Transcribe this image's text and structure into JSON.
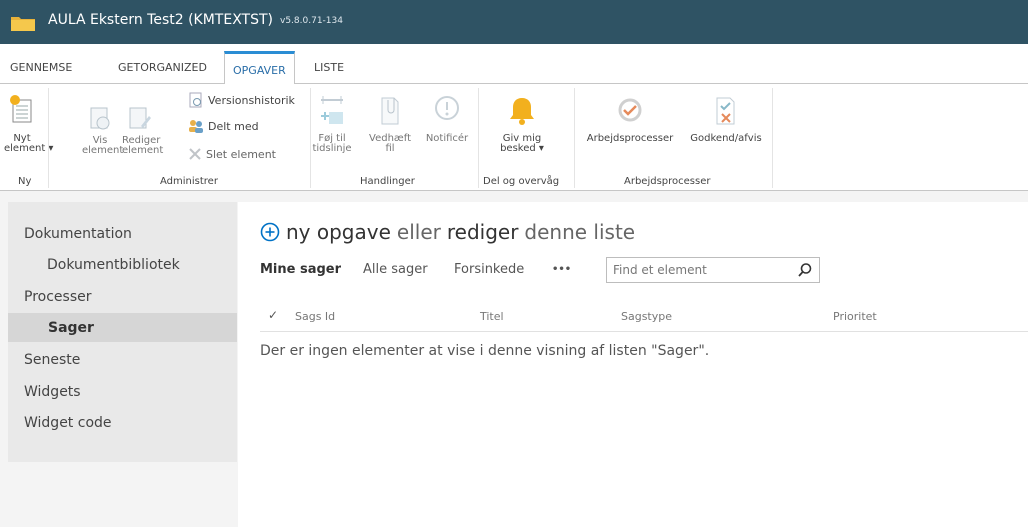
{
  "app": {
    "title": "AULA Ekstern Test2 (KMTEXTST)",
    "version": "v5.8.0.71-134"
  },
  "tabs": [
    "GENNEMSE",
    "GETORGANIZED",
    "OPGAVER",
    "LISTE"
  ],
  "ribbon": {
    "ny": {
      "new_item_line1": "Nyt",
      "new_item_line2": "element",
      "group": "Ny"
    },
    "administrer": {
      "view_line1": "Vis",
      "view_line2": "element",
      "edit_line1": "Rediger",
      "edit_line2": "element",
      "version_history": "Versionshistorik",
      "shared_with": "Delt med",
      "delete": "Slet element",
      "group": "Administrer"
    },
    "handlinger": {
      "timeline_line1": "Føj til",
      "timeline_line2": "tidslinje",
      "attach_line1": "Vedhæft",
      "attach_line2": "fil",
      "notify": "Notificér",
      "group": "Handlinger"
    },
    "del": {
      "alert_line1": "Giv mig",
      "alert_line2": "besked",
      "group": "Del og overvåg"
    },
    "workflows": {
      "processes": "Arbejdsprocesser",
      "approve": "Godkend/afvis",
      "group": "Arbejdsprocesser"
    }
  },
  "sidebar": {
    "items": [
      "Dokumentation",
      "Dokumentbibliotek",
      "Processer",
      "Sager",
      "Seneste",
      "Widgets",
      "Widget code"
    ],
    "selected": "Sager"
  },
  "main": {
    "new_link": "ny opgave",
    "new_link_mid": "eller",
    "edit_link": "rediger",
    "edit_link_tail": "denne liste",
    "views": [
      "Mine sager",
      "Alle sager",
      "Forsinkede"
    ],
    "more": "•••",
    "search_placeholder": "Find et element",
    "columns": [
      "Sags Id",
      "Titel",
      "Sagstype",
      "Prioritet"
    ],
    "empty_message": "Der er ingen elementer at vise i denne visning af listen \"Sager\"."
  },
  "colors": {
    "topbar": "#2f5364",
    "accent": "#2a8dd4",
    "bell": "#f2b01e",
    "link": "#0072c6"
  }
}
